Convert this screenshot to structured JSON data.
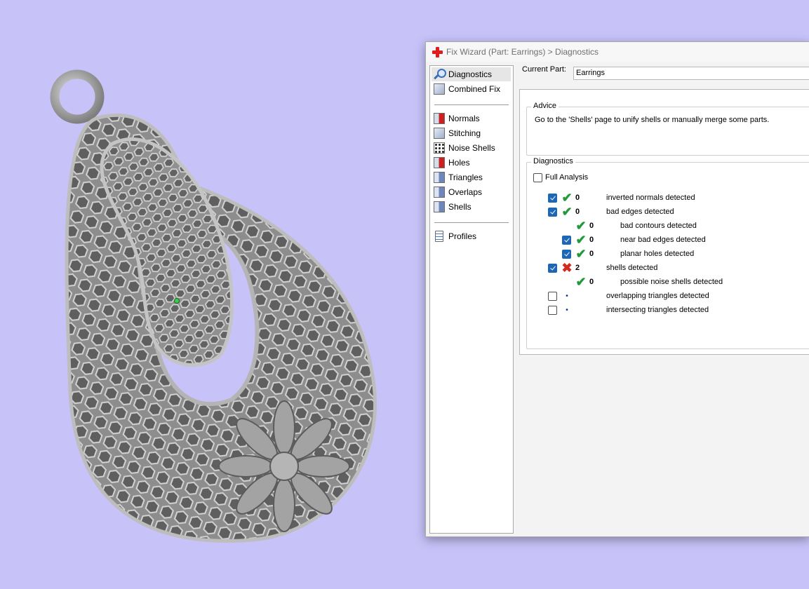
{
  "window": {
    "title": "Fix Wizard (Part: Earrings) > Diagnostics"
  },
  "nav": {
    "items": [
      {
        "label": "Diagnostics",
        "icon": "magnifier-icon",
        "selected": true
      },
      {
        "label": "Combined Fix",
        "icon": "cube-icon"
      },
      {
        "label": "Normals",
        "icon": "cube-normals-icon"
      },
      {
        "label": "Stitching",
        "icon": "cube-stitching-icon"
      },
      {
        "label": "Noise Shells",
        "icon": "noise-shells-icon"
      },
      {
        "label": "Holes",
        "icon": "cube-holes-icon"
      },
      {
        "label": "Triangles",
        "icon": "triangles-icon"
      },
      {
        "label": "Overlaps",
        "icon": "overlaps-icon"
      },
      {
        "label": "Shells",
        "icon": "shells-icon"
      },
      {
        "label": "Profiles",
        "icon": "document-icon"
      }
    ]
  },
  "current_part": {
    "label": "Current Part:",
    "value": "Earrings"
  },
  "advice": {
    "title": "Advice",
    "text": "Go to the 'Shells' page to unify shells or manually merge some parts."
  },
  "diagnostics": {
    "title": "Diagnostics",
    "full_analysis": {
      "label": "Full Analysis",
      "checked": false
    },
    "rows": [
      {
        "label": "inverted normals detected",
        "count": "0",
        "status": "ok",
        "checkbox": true,
        "checked": true,
        "indent": 0
      },
      {
        "label": "bad edges detected",
        "count": "0",
        "status": "ok",
        "checkbox": true,
        "checked": true,
        "indent": 0
      },
      {
        "label": "bad contours detected",
        "count": "0",
        "status": "ok",
        "checkbox": false,
        "checked": false,
        "indent": 1
      },
      {
        "label": "near bad edges detected",
        "count": "0",
        "status": "ok",
        "checkbox": true,
        "checked": true,
        "indent": 1
      },
      {
        "label": "planar holes detected",
        "count": "0",
        "status": "ok",
        "checkbox": true,
        "checked": true,
        "indent": 1
      },
      {
        "label": "shells detected",
        "count": "2",
        "status": "error",
        "checkbox": true,
        "checked": true,
        "indent": 0
      },
      {
        "label": "possible noise shells detected",
        "count": "0",
        "status": "ok",
        "checkbox": false,
        "checked": false,
        "indent": 1
      },
      {
        "label": "overlapping triangles detected",
        "count": "",
        "status": "not-run",
        "checkbox": true,
        "checked": false,
        "indent": 0
      },
      {
        "label": "intersecting triangles detected",
        "count": "",
        "status": "not-run",
        "checkbox": true,
        "checked": false,
        "indent": 0
      }
    ]
  },
  "colors": {
    "background": "#c7c3f9",
    "model": "#9b9b9b",
    "ok": "#239a3a",
    "error": "#d12b1f",
    "checkbox": "#1e66b6"
  }
}
